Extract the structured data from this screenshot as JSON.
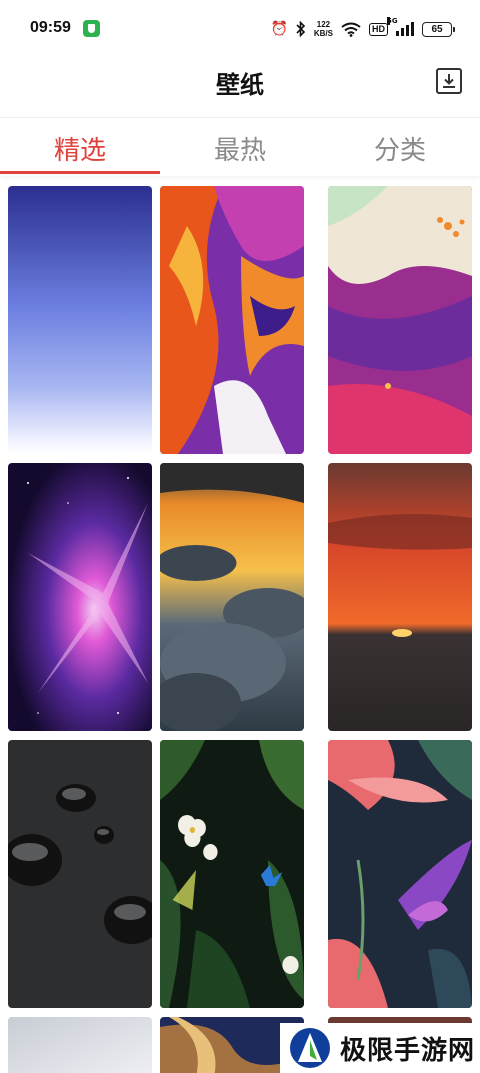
{
  "status_bar": {
    "time": "09:59",
    "speed_value": "122",
    "speed_unit": "KB/S",
    "hd": "HD",
    "network": "5G",
    "battery": "65"
  },
  "header": {
    "title": "壁纸"
  },
  "tabs": [
    {
      "label": "精选",
      "active": true
    },
    {
      "label": "最热",
      "active": false
    },
    {
      "label": "分类",
      "active": false
    }
  ],
  "wallpapers": [
    {
      "name": "blue-gradient"
    },
    {
      "name": "fluid-art-orange-purple"
    },
    {
      "name": "fluid-art-marble"
    },
    {
      "name": "purple-nebula"
    },
    {
      "name": "sunset-clouds"
    },
    {
      "name": "red-sunset-sea"
    },
    {
      "name": "water-drops"
    },
    {
      "name": "jungle-flowers-butterfly"
    },
    {
      "name": "tropical-leaves"
    },
    {
      "name": "silver-gradient"
    },
    {
      "name": "liquid-swirl"
    },
    {
      "name": "dark-partial"
    }
  ],
  "watermark": {
    "text": "极限手游网"
  }
}
